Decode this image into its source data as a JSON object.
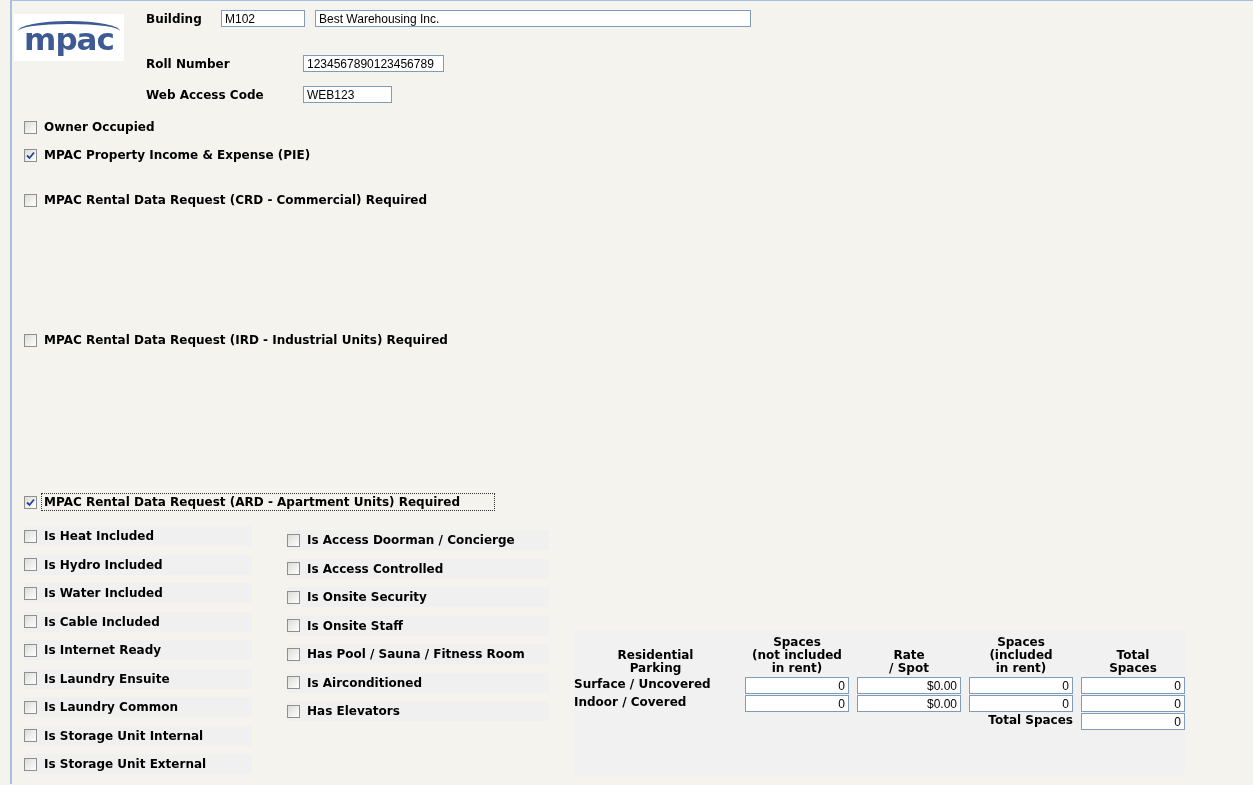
{
  "header": {
    "logo": "mpac",
    "building": {
      "label": "Building",
      "code": "M102",
      "name": "Best Warehousing Inc."
    },
    "roll_number": {
      "label": "Roll Number",
      "value": "1234567890123456789"
    },
    "web_access_code": {
      "label": "Web Access Code",
      "value": "WEB123"
    }
  },
  "owner_occupied": {
    "label": "Owner Occupied",
    "checked": false
  },
  "pie": {
    "label": "MPAC Property Income & Expense (PIE)",
    "checked": true
  },
  "crd": {
    "label": "MPAC Rental Data Request (CRD - Commercial) Required",
    "checked": false
  },
  "ird": {
    "label": "MPAC Rental Data Request (IRD - Industrial Units) Required",
    "checked": false
  },
  "ard": {
    "label": "MPAC Rental Data Request (ARD - Apartment Units) Required",
    "checked": true,
    "focused": true
  },
  "amenities_left": [
    {
      "label": "Is Heat Included",
      "checked": false
    },
    {
      "label": "Is Hydro Included",
      "checked": false
    },
    {
      "label": "Is Water Included",
      "checked": false
    },
    {
      "label": "Is Cable Included",
      "checked": false
    },
    {
      "label": "Is Internet Ready",
      "checked": false
    },
    {
      "label": "Is Laundry Ensuite",
      "checked": false
    },
    {
      "label": "Is Laundry Common",
      "checked": false
    },
    {
      "label": "Is Storage Unit Internal",
      "checked": false
    },
    {
      "label": "Is Storage Unit External",
      "checked": false
    }
  ],
  "amenities_right": [
    {
      "label": "Is Access Doorman / Concierge",
      "checked": false
    },
    {
      "label": "Is Access Controlled",
      "checked": false
    },
    {
      "label": "Is Onsite Security",
      "checked": false
    },
    {
      "label": "Is Onsite Staff",
      "checked": false
    },
    {
      "label": "Has Pool / Sauna / Fitness Room",
      "checked": false
    },
    {
      "label": "Is Airconditioned",
      "checked": false
    },
    {
      "label": "Has Elevators",
      "checked": false
    }
  ],
  "parking": {
    "headings": [
      "Residential\nParking",
      "Spaces\n(not included\nin rent)",
      "Rate\n/ Spot",
      "Spaces\n(included\nin rent)",
      "Total\nSpaces"
    ],
    "rows": [
      {
        "label": "Surface / Uncovered",
        "not_included": "0",
        "rate": "$0.00",
        "included": "0",
        "total": "0"
      },
      {
        "label": "Indoor / Covered",
        "not_included": "0",
        "rate": "$0.00",
        "included": "0",
        "total": "0"
      }
    ],
    "total_label": "Total Spaces",
    "total_value": "0"
  }
}
